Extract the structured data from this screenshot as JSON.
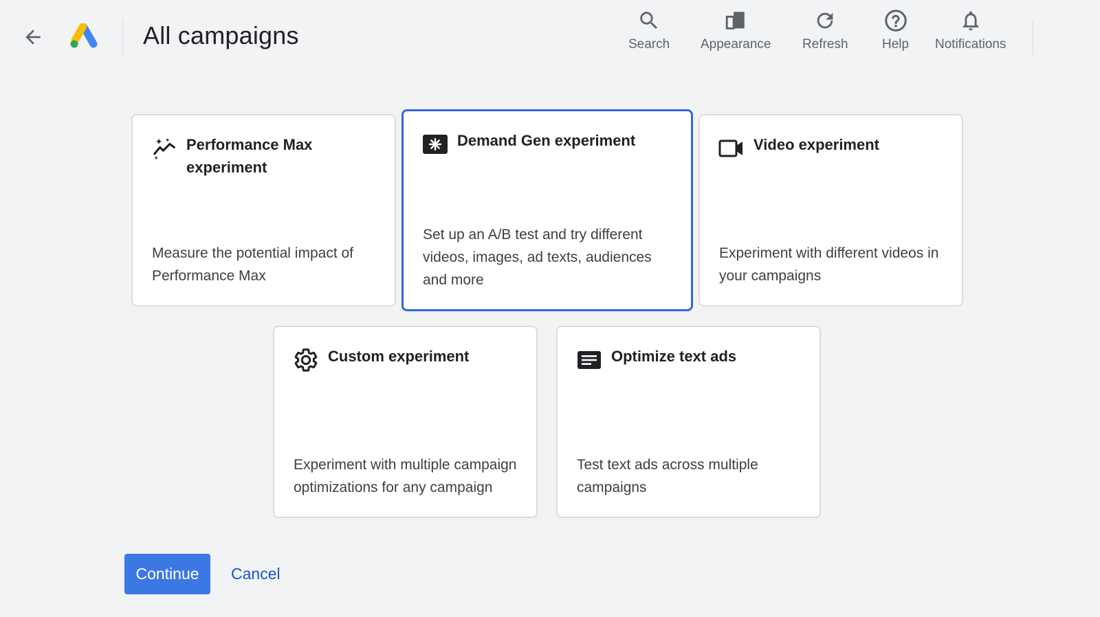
{
  "header": {
    "title": "All campaigns",
    "back_icon": "arrow-back-icon",
    "logo": "google-ads-logo",
    "tools": [
      {
        "label": "Search",
        "icon": "search-icon"
      },
      {
        "label": "Appearance",
        "icon": "appearance-icon"
      },
      {
        "label": "Refresh",
        "icon": "refresh-icon"
      },
      {
        "label": "Help",
        "icon": "help-icon"
      },
      {
        "label": "Notifications",
        "icon": "bell-icon"
      }
    ]
  },
  "cards": [
    {
      "title": "Performance Max experiment",
      "description": "Measure the potential impact of Performance Max",
      "icon": "sparkle-trend-icon",
      "selected": false
    },
    {
      "title": "Demand Gen experiment",
      "description": "Set up an A/B test and try different videos, images, ad texts, audiences and more",
      "icon": "demand-gen-icon",
      "selected": true
    },
    {
      "title": "Video experiment",
      "description": "Experiment with different videos in your campaigns",
      "icon": "video-camera-icon",
      "selected": false
    },
    {
      "title": "Custom experiment",
      "description": "Experiment with multiple campaign optimizations for any campaign",
      "icon": "gear-icon",
      "selected": false
    },
    {
      "title": "Optimize text ads",
      "description": "Test text ads across multiple campaigns",
      "icon": "text-ad-icon",
      "selected": false
    }
  ],
  "actions": {
    "continue_label": "Continue",
    "cancel_label": "Cancel"
  },
  "colors": {
    "background": "#f1f3f4",
    "selected_border": "#3367d6",
    "primary_button": "#3c78e4",
    "link": "#1a56c8"
  }
}
